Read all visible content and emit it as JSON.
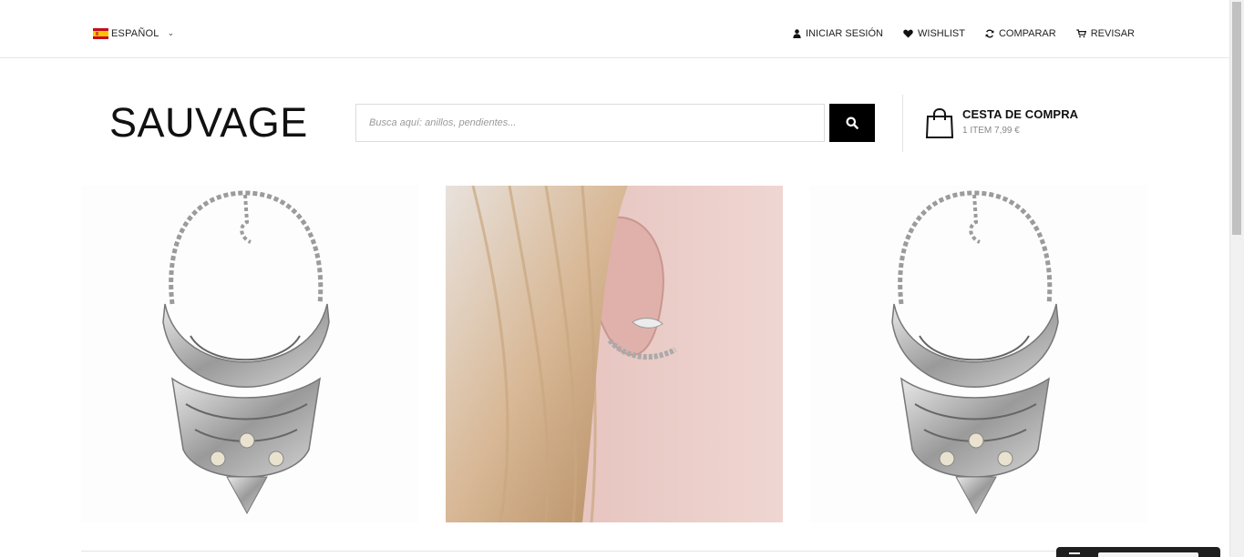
{
  "topbar": {
    "language": {
      "label": "ESPAÑOL",
      "flag": "spain-flag-icon"
    },
    "links": [
      {
        "label": "INICIAR SESIÓN",
        "icon": "user-icon"
      },
      {
        "label": "WISHLIST",
        "icon": "heart-icon"
      },
      {
        "label": "COMPARAR",
        "icon": "refresh-icon"
      },
      {
        "label": "REVISAR",
        "icon": "cart-icon"
      }
    ]
  },
  "header": {
    "logo": "SAUVAGE",
    "search": {
      "placeholder": "Busca aquí: anillos, pendientes...",
      "value": ""
    },
    "cart": {
      "title": "CESTA DE COMPRA",
      "summary": "1 ITEM 7,99 €"
    }
  },
  "products": [
    {
      "kind": "statement necklace"
    },
    {
      "kind": "ear cuff earring photo"
    },
    {
      "kind": "statement necklace"
    }
  ],
  "colors": {
    "accent": "#000000",
    "border": "#dcdcdc",
    "muted": "#888888"
  }
}
